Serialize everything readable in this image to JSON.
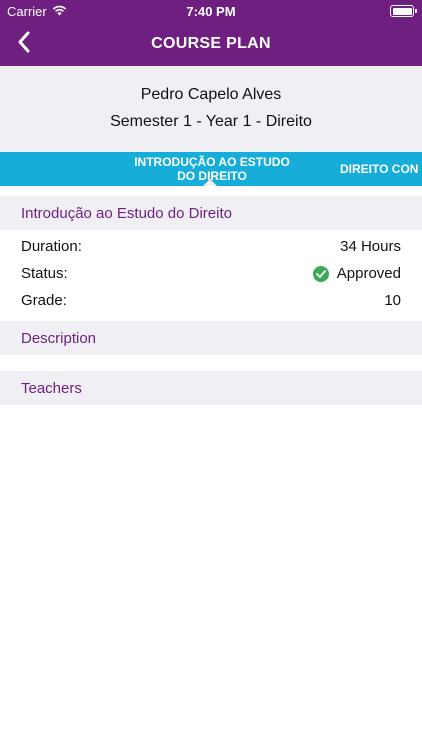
{
  "statusbar": {
    "carrier": "Carrier",
    "time": "7:40 PM"
  },
  "header": {
    "title": "COURSE PLAN"
  },
  "profile": {
    "name": "Pedro Capelo Alves",
    "semester": "Semester 1 - Year 1 - Direito"
  },
  "tabs": [
    {
      "label": "INTRODUÇÃO AO ESTUDO DO DIREITO",
      "line1": "INTRODUÇÃO AO ESTUDO",
      "line2": "DO DIREITO",
      "active": true
    },
    {
      "label": "DIREITO CON",
      "active": false
    }
  ],
  "course": {
    "title": "Introdução ao Estudo do Direito",
    "details": [
      {
        "label": "Duration:",
        "value": "34 Hours"
      },
      {
        "label": "Status:",
        "value": "Approved"
      },
      {
        "label": "Grade:",
        "value": "10"
      }
    ]
  },
  "sections": {
    "description": "Description",
    "teachers": "Teachers"
  },
  "colors": {
    "brand": "#6e1f7f",
    "tabs": "#16aed9",
    "section_bg": "#f0eff4",
    "approved": "#3aaa55"
  },
  "icons": {
    "back": "chevron-left-icon",
    "status": "checkmark-circle-icon",
    "wifi": "wifi-icon",
    "battery": "battery-icon"
  }
}
